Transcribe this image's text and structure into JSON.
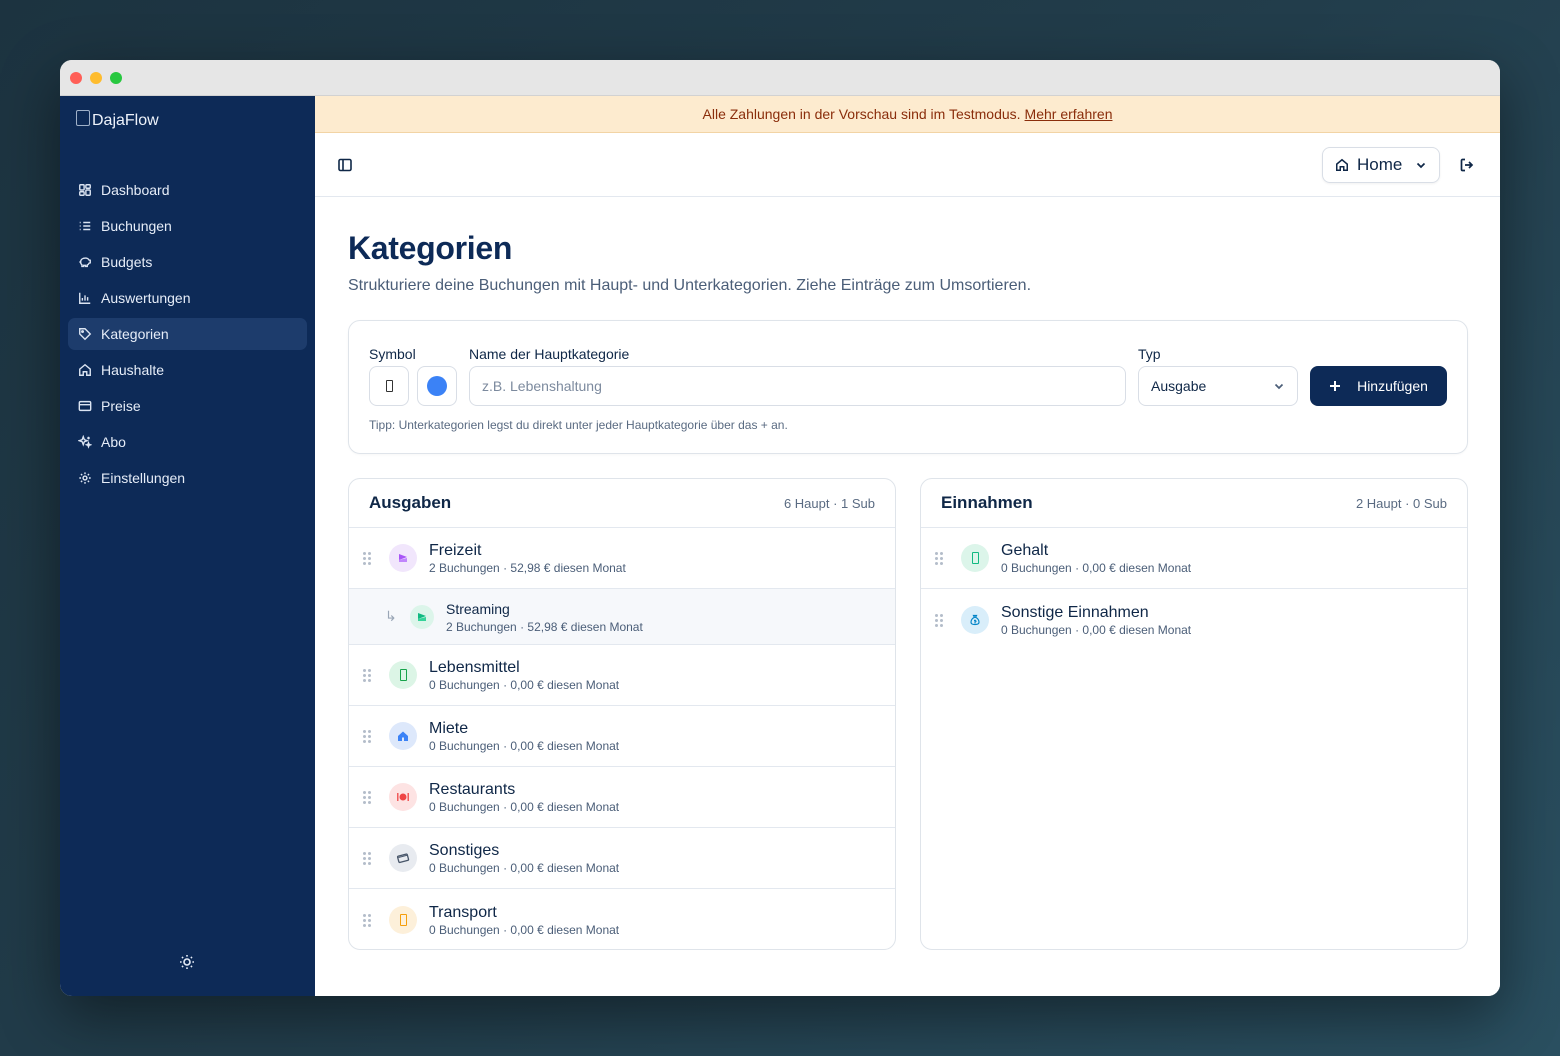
{
  "app": {
    "logo_alt": "DajaFlow"
  },
  "sidebar": {
    "items": [
      {
        "label": "Dashboard",
        "icon": "dashboard-icon"
      },
      {
        "label": "Buchungen",
        "icon": "list-icon"
      },
      {
        "label": "Budgets",
        "icon": "piggy-bank-icon"
      },
      {
        "label": "Auswertungen",
        "icon": "bar-chart-icon"
      },
      {
        "label": "Kategorien",
        "icon": "tag-icon",
        "active": true
      },
      {
        "label": "Haushalte",
        "icon": "home-icon"
      },
      {
        "label": "Preise",
        "icon": "credit-card-icon"
      },
      {
        "label": "Abo",
        "icon": "sparkles-icon"
      },
      {
        "label": "Einstellungen",
        "icon": "gear-icon"
      }
    ]
  },
  "banner": {
    "text": "Alle Zahlungen in der Vorschau sind im Testmodus.",
    "link": "Mehr erfahren"
  },
  "topbar": {
    "household": "Home"
  },
  "page": {
    "title": "Kategorien",
    "subtitle": "Strukturiere deine Buchungen mit Haupt- und Unterkategorien. Ziehe Einträge zum Umsortieren."
  },
  "form": {
    "symbol_label": "Symbol",
    "name_label": "Name der Hauptkategorie",
    "name_placeholder": "z.B. Lebenshaltung",
    "type_label": "Typ",
    "type_value": "Ausgabe",
    "add_label": "Hinzufügen",
    "color": "#3b82f6",
    "tip": "Tipp: Unterkategorien legst du direkt unter jeder Hauptkategorie über das + an."
  },
  "expenses": {
    "title": "Ausgaben",
    "count": "6 Haupt · 1 Sub",
    "items": [
      {
        "name": "Freizeit",
        "meta": "2 Buchungen · 52,98 € diesen Monat"
      },
      {
        "name": "Streaming",
        "meta": "2 Buchungen · 52,98 € diesen Monat"
      },
      {
        "name": "Lebensmittel",
        "meta": "0 Buchungen · 0,00 € diesen Monat"
      },
      {
        "name": "Miete",
        "meta": "0 Buchungen · 0,00 € diesen Monat"
      },
      {
        "name": "Restaurants",
        "meta": "0 Buchungen · 0,00 € diesen Monat"
      },
      {
        "name": "Sonstiges",
        "meta": "0 Buchungen · 0,00 € diesen Monat"
      },
      {
        "name": "Transport",
        "meta": "0 Buchungen · 0,00 € diesen Monat"
      }
    ]
  },
  "income": {
    "title": "Einnahmen",
    "count": "2 Haupt · 0 Sub",
    "items": [
      {
        "name": "Gehalt",
        "meta": "0 Buchungen · 0,00 € diesen Monat"
      },
      {
        "name": "Sonstige Einnahmen",
        "meta": "0 Buchungen · 0,00 € diesen Monat"
      }
    ]
  }
}
